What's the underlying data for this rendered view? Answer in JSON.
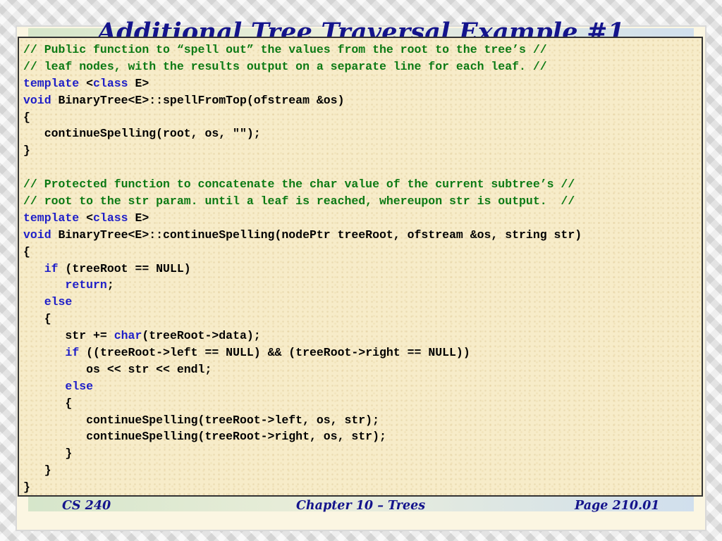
{
  "slide": {
    "title": "Additional Tree Traversal Example #1"
  },
  "colors": {
    "title": "#14148c",
    "comment": "#0c7a14",
    "keyword": "#1e1ec8",
    "code": "#000000",
    "code_background": "#f7ecc9"
  },
  "code_lines": [
    [
      {
        "style": "comment",
        "text": "// Public function to “spell out” the values from the root to the tree’s //"
      }
    ],
    [
      {
        "style": "comment",
        "text": "// leaf nodes, with the results output on a separate line for each leaf. //"
      }
    ],
    [
      {
        "style": "keyword",
        "text": "template"
      },
      {
        "style": "text",
        "text": " <"
      },
      {
        "style": "keyword",
        "text": "class"
      },
      {
        "style": "text",
        "text": " E>"
      }
    ],
    [
      {
        "style": "keyword",
        "text": "void"
      },
      {
        "style": "text",
        "text": " BinaryTree<E>::spellFromTop(ofstream &os)"
      }
    ],
    [
      {
        "style": "text",
        "text": "{"
      }
    ],
    [
      {
        "style": "text",
        "text": "   continueSpelling(root, os, \"\");"
      }
    ],
    [
      {
        "style": "text",
        "text": "}"
      }
    ],
    [
      {
        "style": "text",
        "text": ""
      }
    ],
    [
      {
        "style": "comment",
        "text": "// Protected function to concatenate the char value of the current subtree’s //"
      }
    ],
    [
      {
        "style": "comment",
        "text": "// root to the str param. until a leaf is reached, whereupon str is output.  //"
      }
    ],
    [
      {
        "style": "keyword",
        "text": "template"
      },
      {
        "style": "text",
        "text": " <"
      },
      {
        "style": "keyword",
        "text": "class"
      },
      {
        "style": "text",
        "text": " E>"
      }
    ],
    [
      {
        "style": "keyword",
        "text": "void"
      },
      {
        "style": "text",
        "text": " BinaryTree<E>::continueSpelling(nodePtr treeRoot, ofstream &os, string str)"
      }
    ],
    [
      {
        "style": "text",
        "text": "{"
      }
    ],
    [
      {
        "style": "text",
        "text": "   "
      },
      {
        "style": "keyword",
        "text": "if"
      },
      {
        "style": "text",
        "text": " (treeRoot == NULL)"
      }
    ],
    [
      {
        "style": "text",
        "text": "      "
      },
      {
        "style": "keyword",
        "text": "return"
      },
      {
        "style": "text",
        "text": ";"
      }
    ],
    [
      {
        "style": "text",
        "text": "   "
      },
      {
        "style": "keyword",
        "text": "else"
      }
    ],
    [
      {
        "style": "text",
        "text": "   {"
      }
    ],
    [
      {
        "style": "text",
        "text": "      str += "
      },
      {
        "style": "keyword",
        "text": "char"
      },
      {
        "style": "text",
        "text": "(treeRoot->data);"
      }
    ],
    [
      {
        "style": "text",
        "text": "      "
      },
      {
        "style": "keyword",
        "text": "if"
      },
      {
        "style": "text",
        "text": " ((treeRoot->left == NULL) && (treeRoot->right == NULL))"
      }
    ],
    [
      {
        "style": "text",
        "text": "         os << str << endl;"
      }
    ],
    [
      {
        "style": "text",
        "text": "      "
      },
      {
        "style": "keyword",
        "text": "else"
      }
    ],
    [
      {
        "style": "text",
        "text": "      {"
      }
    ],
    [
      {
        "style": "text",
        "text": "         continueSpelling(treeRoot->left, os, str);"
      }
    ],
    [
      {
        "style": "text",
        "text": "         continueSpelling(treeRoot->right, os, str);"
      }
    ],
    [
      {
        "style": "text",
        "text": "      }"
      }
    ],
    [
      {
        "style": "text",
        "text": "   }"
      }
    ],
    [
      {
        "style": "text",
        "text": "}"
      }
    ]
  ],
  "footer": {
    "course": "CS 240",
    "chapter": "Chapter 10 – Trees",
    "page": "Page 210.01"
  }
}
